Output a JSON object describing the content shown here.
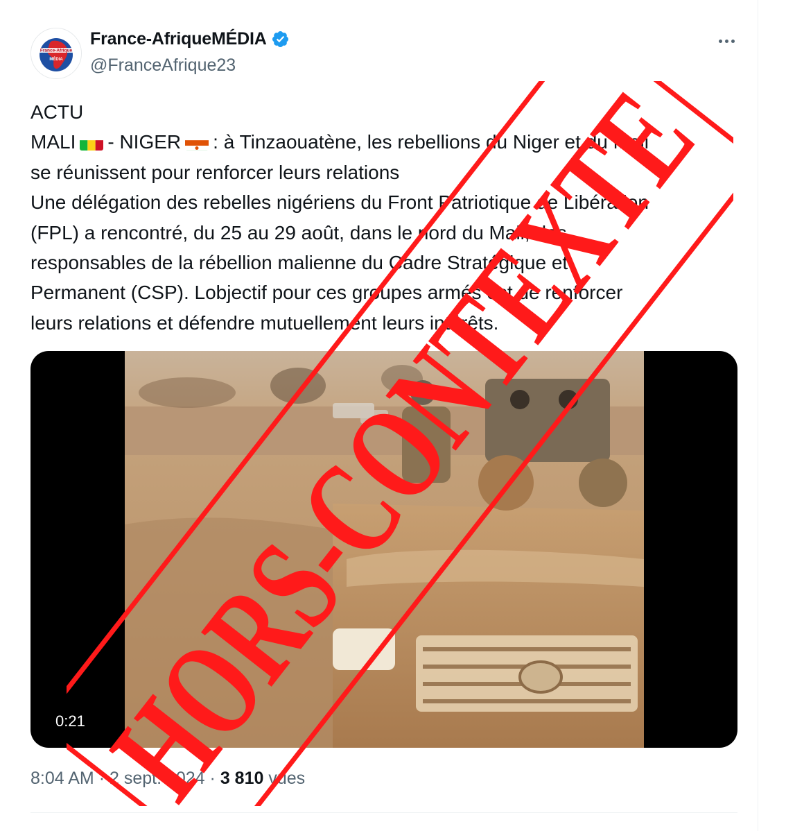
{
  "author": {
    "display_name": "France-AfriqueMÉDIA",
    "handle": "@FranceAfrique23",
    "avatar_text_top": "France-Afrique",
    "avatar_text_bottom": "MÉDIA",
    "verified": true
  },
  "tweet": {
    "line1": "ACTU",
    "line2_a": "MALI",
    "line2_b": "- NIGER",
    "line2_c": ": à Tinzaouatène, les rebellions du Niger et du Mali",
    "line3": "se réunissent pour renforcer leurs relations",
    "line4": "Une délégation des rebelles nigériens du Front Patriotique de Libération",
    "line5": "(FPL) a rencontré, du 25 au 29 août, dans le nord du Mali, des",
    "line6": "responsables de la rébellion malienne du Cadre Stratégique et",
    "line7": "Permanent (CSP). Lobjectif pour ces groupes armés est de renforcer",
    "line8": "leurs relations et défendre mutuellement leurs intérêts."
  },
  "media": {
    "duration": "0:21"
  },
  "meta": {
    "time": "8:04 AM",
    "separator": "·",
    "date": "2 sept. 2024",
    "views_count": "3 810",
    "views_label": "vues"
  },
  "stamp": {
    "text": "HORS-CONTEXTE",
    "color": "#ff1a1a"
  },
  "colors": {
    "text": "#0f1419",
    "secondary": "#536471",
    "verified_blue": "#1d9bf0",
    "divider": "#eff3f4"
  },
  "icons": {
    "verified": "verified-badge-icon",
    "more": "more-options-icon",
    "mali_flag": "mali-flag-icon",
    "niger_flag": "niger-flag-icon"
  }
}
